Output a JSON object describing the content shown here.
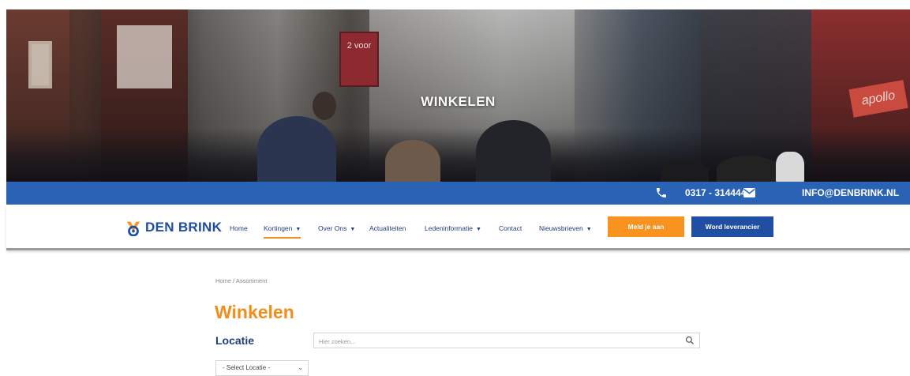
{
  "hero": {
    "title": "WINKELEN",
    "sign_text": "2 voor",
    "shop_sign": "apollo"
  },
  "topbar": {
    "phone": "0317 - 314444",
    "email": "INFO@DENBRINK.NL",
    "phone_icon": "phone-icon",
    "mail_icon": "mail-icon",
    "background": "#2a63b6"
  },
  "nav": {
    "logo_text": "DEN BRINK",
    "items": [
      {
        "label": "Home"
      },
      {
        "label": "Kortingen"
      },
      {
        "label": "Over Ons"
      },
      {
        "label": "Actualiteiten"
      },
      {
        "label": "Ledeninformatie"
      },
      {
        "label": "Contact"
      },
      {
        "label": "Nieuwsbrieven"
      }
    ],
    "cta_primary": "Meld je aan",
    "cta_secondary": "Word leverancier",
    "accent_orange": "#f7931e",
    "accent_blue": "#1f4ea3"
  },
  "content": {
    "breadcrumb": "Home / Assortiment",
    "title": "Winkelen",
    "locatie_label": "Locatie",
    "search_placeholder": "Hier zoeken...",
    "select_value": "- Select Locatie -"
  }
}
